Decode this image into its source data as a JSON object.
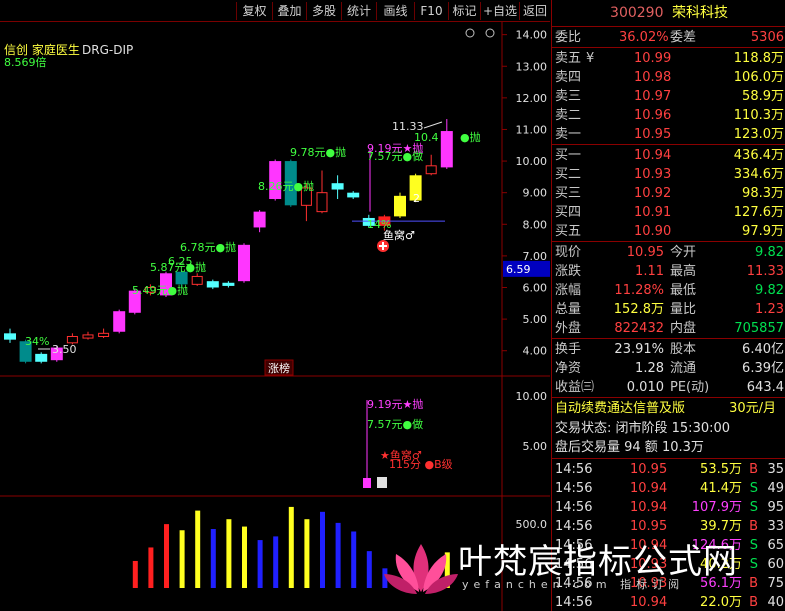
{
  "toolbar": {
    "buttons": [
      "复权",
      "叠加",
      "多股",
      "统计",
      "画线",
      "F10",
      "标记",
      "+自选",
      "返回"
    ]
  },
  "chart": {
    "indicator_title": "信创 家庭医生",
    "indicator_name": "DRG-DIP",
    "multiplier": "8.569倍",
    "zhangbang": "涨榜",
    "price_tag": "6.59",
    "ann": {
      "a1": "9.78元●抛",
      "a2": "8.26元●抛",
      "a3": "6.78元●抛",
      "a4": "6.25",
      "a5": "5.87元●抛",
      "a6": "5.49元●抛",
      "a7": "34%",
      "a8": "3.50",
      "a9": "11.33",
      "a10": "9.19元★抛",
      "a11": "7.57元●做",
      "a12": "10.4",
      "a13": "●抛",
      "a14": "14%",
      "a15": "鱼窝♂",
      "a16": "2",
      "b1": "9.19元★抛",
      "b2": "7.57元●做",
      "b3": "★鱼窝♂",
      "b4": "115分 ●B级"
    },
    "price_axis": [
      "14.00",
      "13.00",
      "12.00",
      "11.00",
      "10.00",
      "9.00",
      "8.00",
      "7.00",
      "6.00",
      "5.00",
      "4.00"
    ],
    "mid_axis": [
      "10.00",
      "5.00"
    ],
    "vol_axis": [
      "500.0"
    ]
  },
  "chart_data": {
    "type": "bar",
    "title": "",
    "ylim": [
      3.2,
      14.4
    ],
    "candles": [
      {
        "o": 4.35,
        "c": 4.55,
        "h": 4.7,
        "l": 4.25,
        "color": "cyan"
      },
      {
        "o": 4.3,
        "c": 3.65,
        "h": 4.35,
        "l": 3.6,
        "color": "teal"
      },
      {
        "o": 3.65,
        "c": 3.9,
        "h": 3.95,
        "l": 3.6,
        "color": "cyan"
      },
      {
        "o": 3.7,
        "c": 4.1,
        "h": 4.15,
        "l": 3.65,
        "color": "magenta"
      },
      {
        "o": 4.25,
        "c": 4.45,
        "h": 4.55,
        "l": 4.2,
        "color": "red-hollow"
      },
      {
        "o": 4.4,
        "c": 4.5,
        "h": 4.6,
        "l": 4.35,
        "color": "red-hollow"
      },
      {
        "o": 4.45,
        "c": 4.55,
        "h": 4.7,
        "l": 4.4,
        "color": "red-hollow"
      },
      {
        "o": 4.6,
        "c": 5.25,
        "h": 5.3,
        "l": 4.55,
        "color": "magenta"
      },
      {
        "o": 5.2,
        "c": 5.9,
        "h": 5.95,
        "l": 5.15,
        "color": "magenta"
      },
      {
        "o": 5.85,
        "c": 6.0,
        "h": 6.1,
        "l": 5.75,
        "color": "red-hollow"
      },
      {
        "o": 5.75,
        "c": 6.45,
        "h": 6.5,
        "l": 5.7,
        "color": "magenta"
      },
      {
        "o": 6.5,
        "c": 6.1,
        "h": 6.55,
        "l": 6.0,
        "color": "teal"
      },
      {
        "o": 6.1,
        "c": 6.35,
        "h": 6.45,
        "l": 6.05,
        "color": "red-hollow"
      },
      {
        "o": 6.2,
        "c": 6.0,
        "h": 6.25,
        "l": 5.95,
        "color": "cyan"
      },
      {
        "o": 6.05,
        "c": 6.15,
        "h": 6.2,
        "l": 6.0,
        "color": "cyan"
      },
      {
        "o": 6.2,
        "c": 7.35,
        "h": 7.4,
        "l": 6.15,
        "color": "magenta"
      },
      {
        "o": 7.9,
        "c": 8.4,
        "h": 8.45,
        "l": 7.75,
        "color": "magenta"
      },
      {
        "o": 8.8,
        "c": 10.0,
        "h": 10.05,
        "l": 8.75,
        "color": "magenta"
      },
      {
        "o": 10.0,
        "c": 8.6,
        "h": 10.05,
        "l": 8.55,
        "color": "teal"
      },
      {
        "o": 8.6,
        "c": 9.15,
        "h": 9.3,
        "l": 8.1,
        "color": "red-hollow"
      },
      {
        "o": 8.4,
        "c": 9.0,
        "h": 9.7,
        "l": 8.35,
        "color": "red-hollow"
      },
      {
        "o": 9.1,
        "c": 9.3,
        "h": 9.55,
        "l": 8.8,
        "color": "cyan"
      },
      {
        "o": 9.0,
        "c": 8.85,
        "h": 9.05,
        "l": 8.8,
        "color": "cyan"
      },
      {
        "o": 7.95,
        "c": 8.2,
        "h": 8.3,
        "l": 7.9,
        "color": "cyan"
      },
      {
        "o": 7.95,
        "c": 8.25,
        "h": 8.3,
        "l": 7.8,
        "color": "red"
      },
      {
        "o": 8.25,
        "c": 8.9,
        "h": 9.0,
        "l": 8.2,
        "color": "yellow"
      },
      {
        "o": 8.75,
        "c": 9.55,
        "h": 9.6,
        "l": 8.7,
        "color": "yellow"
      },
      {
        "o": 9.6,
        "c": 9.85,
        "h": 10.2,
        "l": 9.55,
        "color": "red-hollow"
      },
      {
        "o": 9.8,
        "c": 10.95,
        "h": 11.33,
        "l": 9.75,
        "color": "magenta"
      }
    ],
    "volumes": [
      {
        "v": 0,
        "color": "none"
      },
      {
        "v": 0,
        "color": "none"
      },
      {
        "v": 0,
        "color": "none"
      },
      {
        "v": 0,
        "color": "none"
      },
      {
        "v": 0,
        "color": "none"
      },
      {
        "v": 0,
        "color": "none"
      },
      {
        "v": 0,
        "color": "none"
      },
      {
        "v": 0,
        "color": "none"
      },
      {
        "v": 220,
        "color": "red"
      },
      {
        "v": 330,
        "color": "red"
      },
      {
        "v": 520,
        "color": "red"
      },
      {
        "v": 470,
        "color": "yellow"
      },
      {
        "v": 630,
        "color": "yellow"
      },
      {
        "v": 480,
        "color": "blue"
      },
      {
        "v": 560,
        "color": "yellow"
      },
      {
        "v": 500,
        "color": "yellow"
      },
      {
        "v": 390,
        "color": "blue"
      },
      {
        "v": 420,
        "color": "blue"
      },
      {
        "v": 660,
        "color": "yellow"
      },
      {
        "v": 560,
        "color": "yellow"
      },
      {
        "v": 620,
        "color": "blue"
      },
      {
        "v": 530,
        "color": "blue"
      },
      {
        "v": 460,
        "color": "blue"
      },
      {
        "v": 300,
        "color": "blue"
      },
      {
        "v": 160,
        "color": "blue"
      },
      {
        "v": 0,
        "color": "none"
      },
      {
        "v": 0,
        "color": "none"
      },
      {
        "v": 0,
        "color": "none"
      },
      {
        "v": 290,
        "color": "yellow"
      }
    ],
    "vol_ylim": [
      0,
      700
    ]
  },
  "panel": {
    "code": "300290",
    "name": "荣科科技",
    "webi": {
      "label": "委比",
      "value": "36.02%",
      "label2": "委差",
      "value2": "5306"
    },
    "asks": [
      {
        "label": "卖五",
        "mark": "¥",
        "price": "10.99",
        "vol": "118.8万"
      },
      {
        "label": "卖四",
        "mark": "",
        "price": "10.98",
        "vol": "106.0万"
      },
      {
        "label": "卖三",
        "mark": "",
        "price": "10.97",
        "vol": "58.9万"
      },
      {
        "label": "卖二",
        "mark": "",
        "price": "10.96",
        "vol": "110.3万"
      },
      {
        "label": "卖一",
        "mark": "",
        "price": "10.95",
        "vol": "123.0万"
      }
    ],
    "bids": [
      {
        "label": "买一",
        "price": "10.94",
        "vol": "436.4万"
      },
      {
        "label": "买二",
        "price": "10.93",
        "vol": "334.6万"
      },
      {
        "label": "买三",
        "price": "10.92",
        "vol": "98.3万"
      },
      {
        "label": "买四",
        "price": "10.91",
        "vol": "127.6万"
      },
      {
        "label": "买五",
        "price": "10.90",
        "vol": "97.9万"
      }
    ],
    "quote": [
      {
        "l1": "现价",
        "v1": "10.95",
        "l2": "今开",
        "v2": "9.82",
        "c1": "red",
        "c2": "grn"
      },
      {
        "l1": "涨跌",
        "v1": "1.11",
        "l2": "最高",
        "v2": "11.33",
        "c1": "red",
        "c2": "red"
      },
      {
        "l1": "涨幅",
        "v1": "11.28%",
        "l2": "最低",
        "v2": "9.82",
        "c1": "red",
        "c2": "grn"
      },
      {
        "l1": "总量",
        "v1": "152.8万",
        "l2": "量比",
        "v2": "1.23",
        "c1": "yel",
        "c2": "red"
      },
      {
        "l1": "外盘",
        "v1": "822432",
        "l2": "内盘",
        "v2": "705857",
        "c1": "red",
        "c2": "grn"
      }
    ],
    "stats": [
      {
        "l1": "换手",
        "v1": "23.91%",
        "l2": "股本",
        "v2": "6.40亿"
      },
      {
        "l1": "净资",
        "v1": "1.28",
        "l2": "流通",
        "v2": "6.39亿"
      },
      {
        "l1": "收益㈢",
        "v1": "0.010",
        "l2": "PE(动)",
        "v2": "643.4"
      }
    ],
    "promo": "自动续费通达信普及版",
    "promo_price": "30元/月",
    "trade_status": "交易状态: 闭市阶段 15:30:00",
    "after_hours": "盘后交易量 94 额 10.3万",
    "ticks": [
      {
        "time": "14:56",
        "price": "10.95",
        "vol": "53.5万",
        "bs": "B",
        "n": "35",
        "vc": "yel"
      },
      {
        "time": "14:56",
        "price": "10.94",
        "vol": "41.4万",
        "bs": "S",
        "n": "49",
        "vc": "yel"
      },
      {
        "time": "14:56",
        "price": "10.94",
        "vol": "107.9万",
        "bs": "S",
        "n": "95",
        "vc": "mag"
      },
      {
        "time": "14:56",
        "price": "10.95",
        "vol": "39.7万",
        "bs": "B",
        "n": "33",
        "vc": "yel"
      },
      {
        "time": "14:56",
        "price": "10.94",
        "vol": "124.6万",
        "bs": "S",
        "n": "65",
        "vc": "mag"
      },
      {
        "time": "14:56",
        "price": "10.93",
        "vol": "40.2万",
        "bs": "S",
        "n": "60",
        "vc": "yel"
      },
      {
        "time": "14:56",
        "price": "10.93",
        "vol": "56.1万",
        "bs": "B",
        "n": "75",
        "vc": "mag"
      },
      {
        "time": "14:56",
        "price": "10.94",
        "vol": "22.0万",
        "bs": "B",
        "n": "40",
        "vc": "yel"
      }
    ]
  },
  "watermark": {
    "text": "叶梵宸指标公式网",
    "url": "yefanchen.com 指标订阅"
  }
}
